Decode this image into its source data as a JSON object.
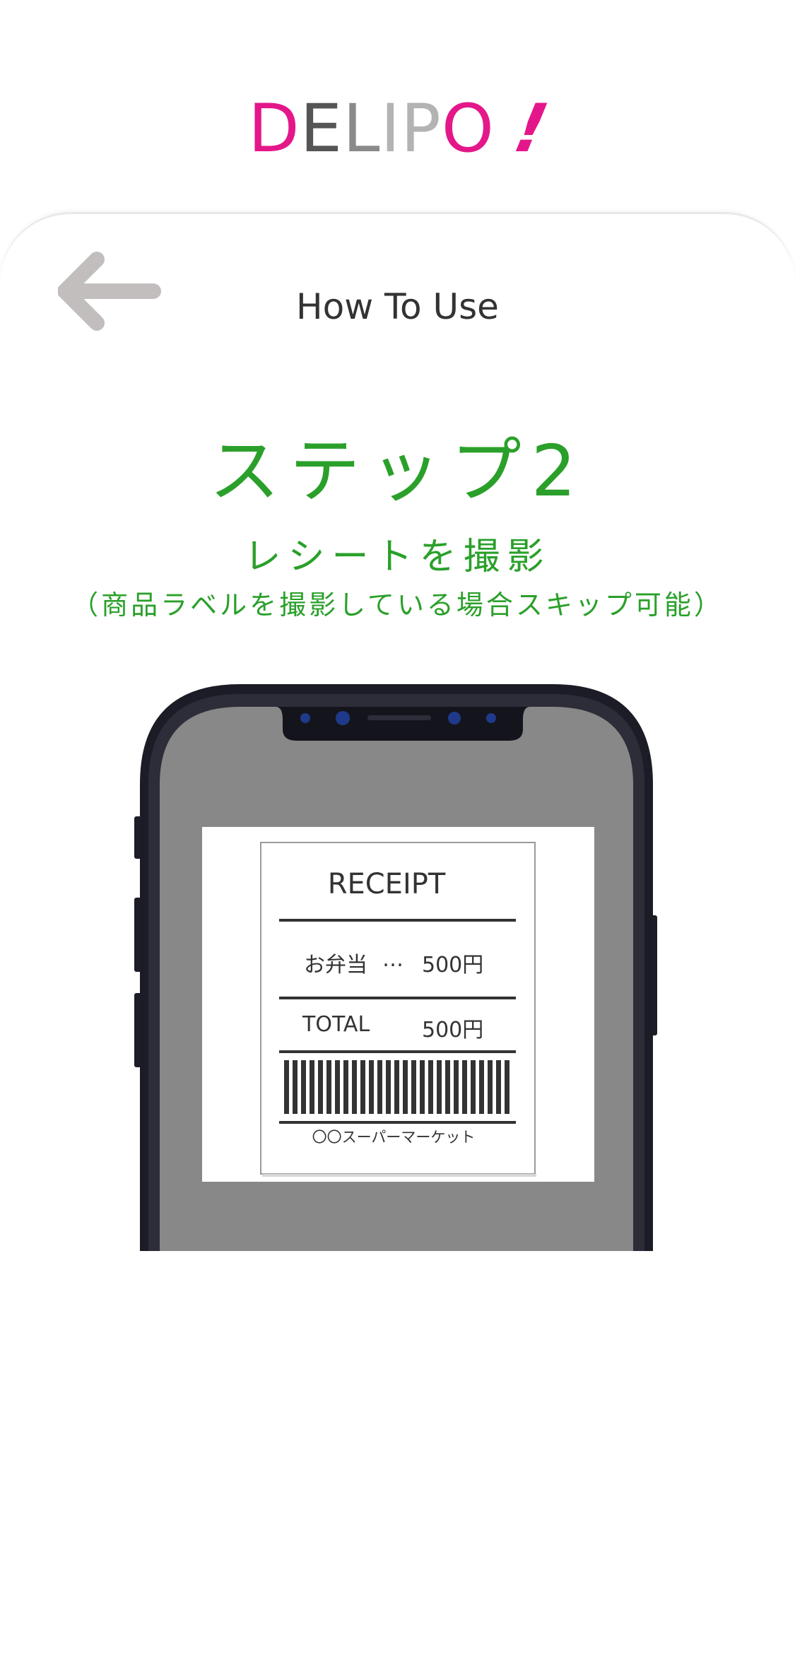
{
  "app": {
    "logo_letters": [
      {
        "ch": "D",
        "color": "#e4178a"
      },
      {
        "ch": "E",
        "color": "#555555"
      },
      {
        "ch": "L",
        "color": "#8a8a8a"
      },
      {
        "ch": "I",
        "color": "#b3b3b3"
      },
      {
        "ch": "P",
        "color": "#b3b3b3"
      },
      {
        "ch": "O",
        "color": "#e4178a"
      }
    ],
    "logo_bang": "!",
    "brand_pink": "#e4178a"
  },
  "header": {
    "title": "How To Use",
    "back_icon": "arrow-left-icon"
  },
  "step": {
    "title": "ステップ2",
    "subtitle": "レシートを撮影",
    "note": "（商品ラベルを撮影している場合スキップ可能）",
    "accent_color": "#2aa02a"
  },
  "receipt": {
    "title": "RECEIPT",
    "item_name": "お弁当",
    "item_dots": "…",
    "item_price": "500円",
    "total_label": "TOTAL",
    "total_price": "500円",
    "store": "〇〇スーパーマーケット"
  }
}
